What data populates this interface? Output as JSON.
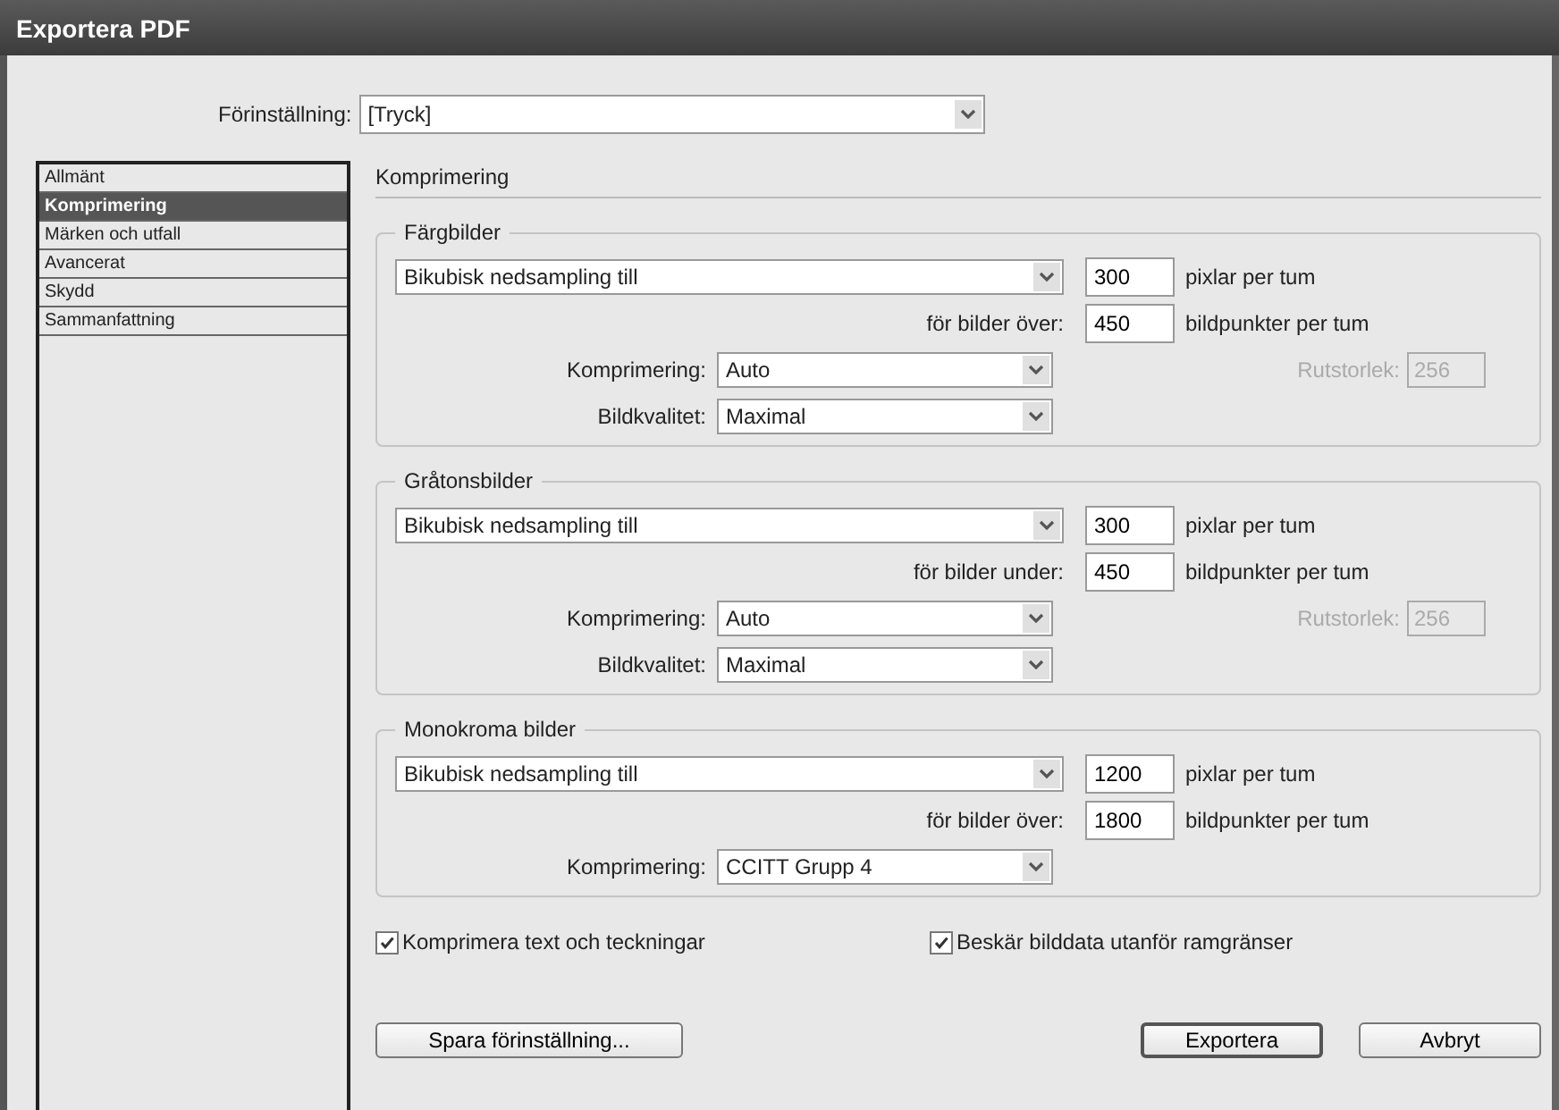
{
  "window": {
    "title": "Exportera PDF"
  },
  "preset": {
    "label": "Förinställning:",
    "value": "[Tryck]"
  },
  "sidebar": {
    "items": [
      {
        "label": "Allmänt",
        "selected": false
      },
      {
        "label": "Komprimering",
        "selected": true
      },
      {
        "label": "Märken och utfall",
        "selected": false
      },
      {
        "label": "Avancerat",
        "selected": false
      },
      {
        "label": "Skydd",
        "selected": false
      },
      {
        "label": "Sammanfattning",
        "selected": false
      }
    ]
  },
  "panel_title": "Komprimering",
  "groups": [
    {
      "title": "Färgbilder",
      "method": "Bikubisk nedsampling till",
      "resolution": "300",
      "resolution_unit": "pixlar per tum",
      "threshold_label": "för bilder över:",
      "threshold": "450",
      "threshold_unit": "bildpunkter per tum",
      "compression_label": "Komprimering:",
      "compression": "Auto",
      "quality_label": "Bildkvalitet:",
      "quality": "Maximal",
      "tile_label": "Rutstorlek:",
      "tile": "256",
      "tile_disabled": true
    },
    {
      "title": "Gråtonsbilder",
      "method": "Bikubisk nedsampling till",
      "resolution": "300",
      "resolution_unit": "pixlar per tum",
      "threshold_label": "för bilder under:",
      "threshold": "450",
      "threshold_unit": "bildpunkter per tum",
      "compression_label": "Komprimering:",
      "compression": "Auto",
      "quality_label": "Bildkvalitet:",
      "quality": "Maximal",
      "tile_label": "Rutstorlek:",
      "tile": "256",
      "tile_disabled": true
    },
    {
      "title": "Monokroma bilder",
      "method": "Bikubisk nedsampling till",
      "resolution": "1200",
      "resolution_unit": "pixlar per tum",
      "threshold_label": "för bilder över:",
      "threshold": "1800",
      "threshold_unit": "bildpunkter per tum",
      "compression_label": "Komprimering:",
      "compression": "CCITT Grupp 4"
    }
  ],
  "options": [
    {
      "label": "Komprimera text och teckningar",
      "checked": true
    },
    {
      "label": "Beskär bilddata utanför ramgränser",
      "checked": true
    }
  ],
  "buttons": [
    {
      "label": "Spara förinställning...",
      "default": false
    },
    {
      "label": "Exportera",
      "default": true
    },
    {
      "label": "Avbryt",
      "default": false
    }
  ]
}
